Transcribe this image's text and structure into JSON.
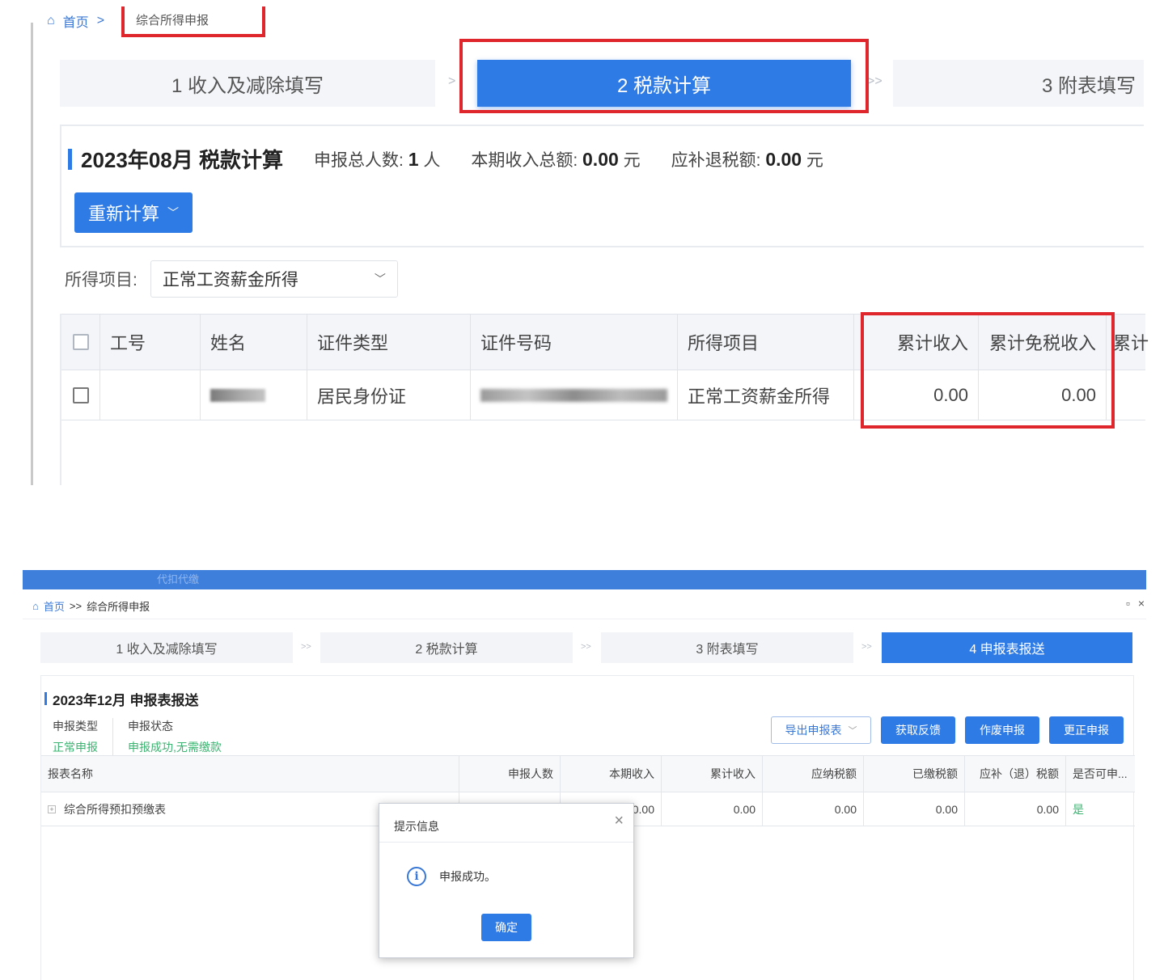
{
  "top": {
    "breadcrumb": {
      "home": "首页",
      "separator": ">",
      "current": "综合所得申报"
    },
    "steps": [
      {
        "label": "1 收入及减除填写"
      },
      {
        "label": "2 税款计算"
      },
      {
        "label": "3 附表填写"
      }
    ],
    "step_arrows": [
      ">",
      ">>"
    ],
    "title": "2023年08月  税款计算",
    "stats": {
      "people_label": "申报总人数:",
      "people_value": "1",
      "people_unit": "人",
      "income_label": "本期收入总额:",
      "income_value": "0.00",
      "income_unit": "元",
      "tax_label": "应补退税额:",
      "tax_value": "0.00",
      "tax_unit": "元"
    },
    "recalc_label": "重新计算",
    "filter": {
      "label": "所得项目:",
      "value": "正常工资薪金所得"
    },
    "table": {
      "headers": [
        "工号",
        "姓名",
        "证件类型",
        "证件号码",
        "所得项目",
        "累计收入",
        "累计免税收入",
        "累计"
      ],
      "rows": [
        {
          "id": "",
          "name": "",
          "id_type": "居民身份证",
          "id_number": "",
          "item": "正常工资薪金所得",
          "cum_income": "0.00",
          "cum_exempt": "0.00"
        }
      ]
    }
  },
  "bottom": {
    "top_band_text": "代扣代缴",
    "breadcrumb": {
      "home": "首页",
      "separator": ">>",
      "current": "综合所得申报"
    },
    "window_buttons": [
      "▫",
      "×"
    ],
    "steps": [
      {
        "label": "1 收入及减除填写"
      },
      {
        "label": "2 税款计算"
      },
      {
        "label": "3 附表填写"
      },
      {
        "label": "4 申报表报送"
      }
    ],
    "step_arrow": ">>",
    "title": "2023年12月  申报表报送",
    "info": {
      "type_label": "申报类型",
      "type_value": "正常申报",
      "status_label": "申报状态",
      "status_value": "申报成功,无需缴款"
    },
    "buttons": {
      "export": "导出申报表",
      "feedback": "获取反馈",
      "void": "作废申报",
      "correct": "更正申报"
    },
    "table": {
      "headers": [
        "报表名称",
        "申报人数",
        "本期收入",
        "累计收入",
        "应纳税额",
        "已缴税额",
        "应补（退）税额",
        "是否可申..."
      ],
      "rows": [
        {
          "name": "综合所得预扣预缴表",
          "people": "",
          "income": "0.00",
          "cum_income": "0.00",
          "tax_due": "0.00",
          "tax_paid": "0.00",
          "refund": "0.00",
          "can_file": "是"
        }
      ]
    },
    "dialog": {
      "title": "提示信息",
      "message": "申报成功。",
      "ok": "确定",
      "info_glyph": "i",
      "close_glyph": "×"
    }
  },
  "colors": {
    "primary": "#2f7be6",
    "highlight_red": "#e0262d",
    "success_green": "#3cb371"
  }
}
